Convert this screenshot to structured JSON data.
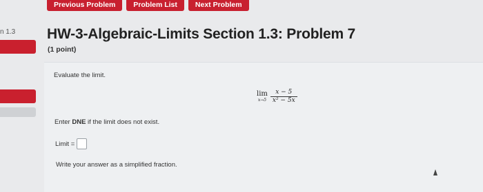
{
  "nav": {
    "previous_label": "Previous Problem",
    "list_label": "Problem List",
    "next_label": "Next Problem"
  },
  "sidebar": {
    "section_label": "n 1.3"
  },
  "problem": {
    "title": "HW-3-Algebraic-Limits Section 1.3: Problem 7",
    "points": "(1 point)",
    "prompt": "Evaluate the limit.",
    "limit": {
      "operator": "lim",
      "approach": "x→5",
      "numerator": "x − 5",
      "denominator": "x² − 5x"
    },
    "dne_prefix": "Enter ",
    "dne_bold": "DNE",
    "dne_suffix": " if the limit does not exist.",
    "answer_label": "Limit =",
    "answer_value": "",
    "hint": "Write your answer as a simplified fraction."
  },
  "colors": {
    "accent": "#c8202f",
    "background": "#e9eaec",
    "panel": "#eef0f2"
  }
}
